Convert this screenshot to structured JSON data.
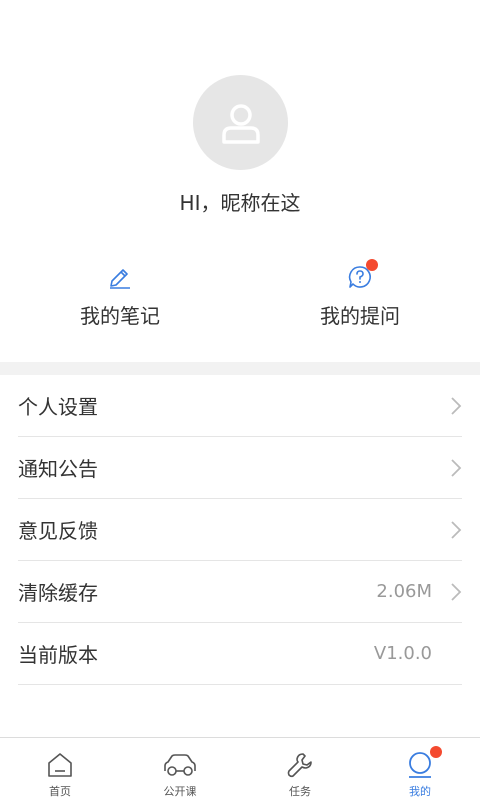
{
  "profile": {
    "greeting": "HI，昵称在这"
  },
  "quick_actions": [
    {
      "label": "我的笔记",
      "icon": "pencil-icon"
    },
    {
      "label": "我的提问",
      "icon": "question-bubble-icon",
      "has_badge": true
    }
  ],
  "menu": [
    {
      "label": "个人设置",
      "value": "",
      "has_arrow": true
    },
    {
      "label": "通知公告",
      "value": "",
      "has_arrow": true
    },
    {
      "label": "意见反馈",
      "value": "",
      "has_arrow": true
    },
    {
      "label": "清除缓存",
      "value": "2.06M",
      "has_arrow": true
    },
    {
      "label": "当前版本",
      "value": "V1.0.0",
      "has_arrow": false
    }
  ],
  "tabbar": {
    "items": [
      {
        "label": "首页",
        "icon": "home-icon",
        "active": false
      },
      {
        "label": "公开课",
        "icon": "car-icon",
        "active": false
      },
      {
        "label": "任务",
        "icon": "wrench-icon",
        "active": false
      },
      {
        "label": "我的",
        "icon": "user-icon",
        "active": true,
        "has_badge": true
      }
    ]
  },
  "colors": {
    "accent": "#3a7de0",
    "badge": "#f44a2f",
    "divider": "#f2f2f2",
    "avatar_bg": "#e6e6e6"
  }
}
